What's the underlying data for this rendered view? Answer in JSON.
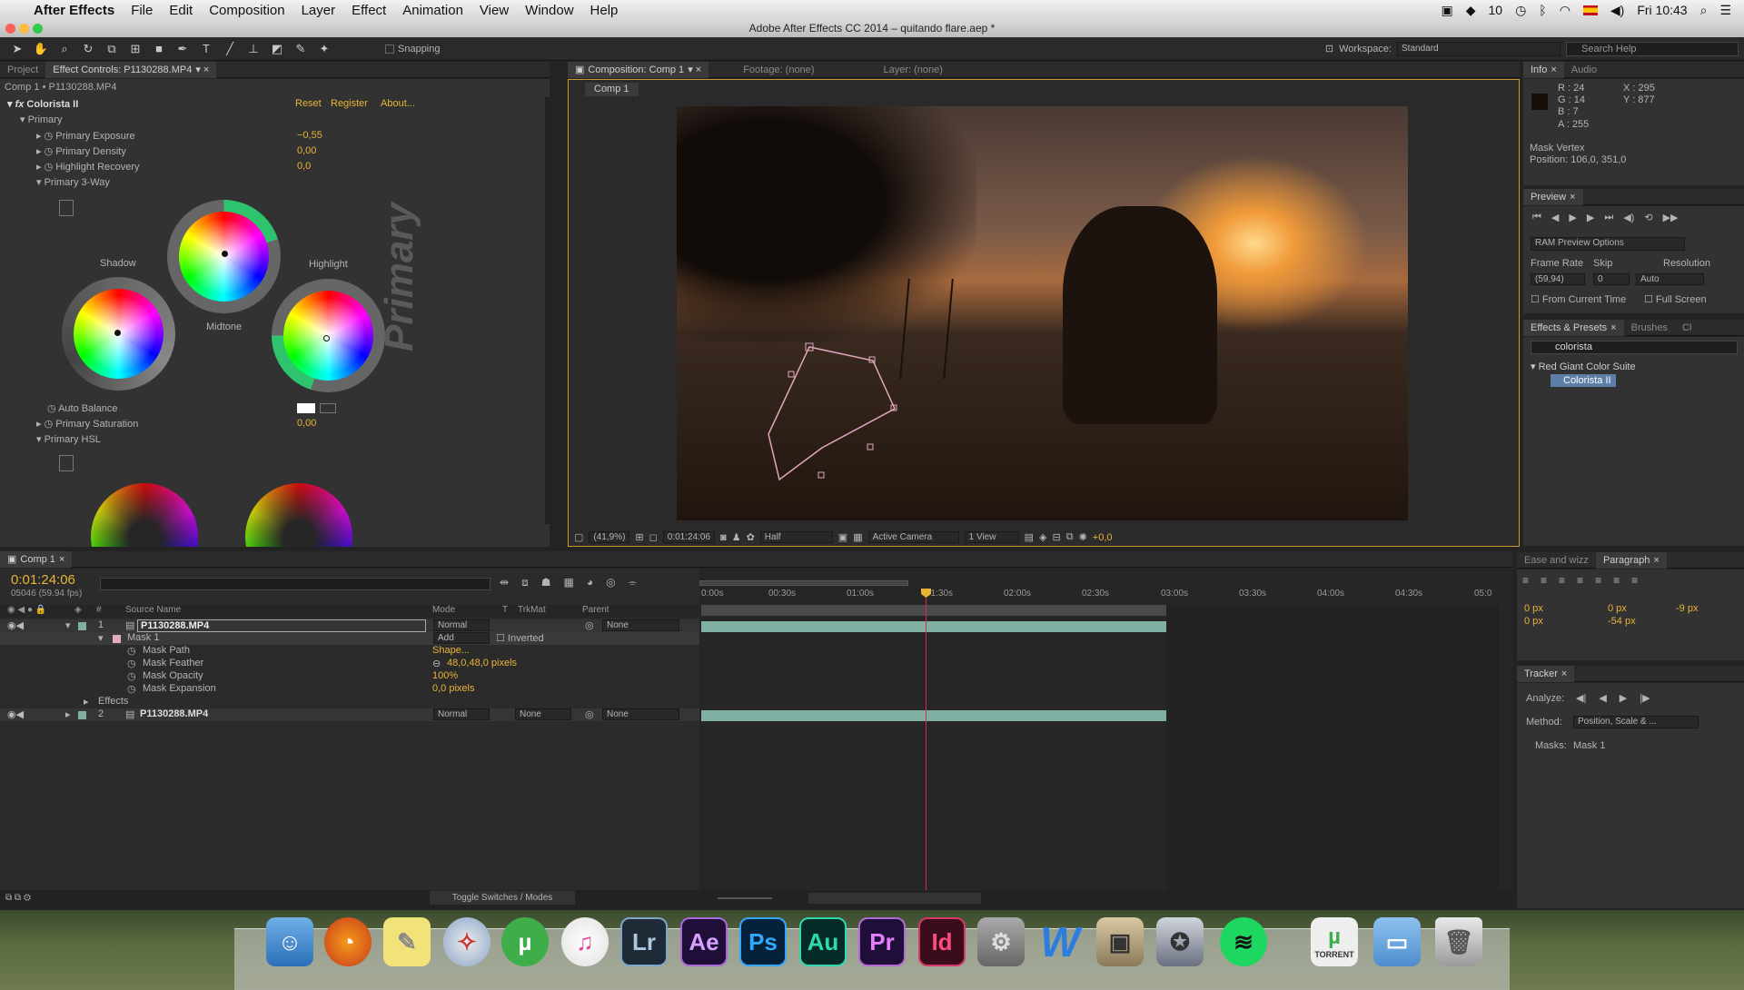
{
  "menubar": {
    "app": "After Effects",
    "items": [
      "File",
      "Edit",
      "Composition",
      "Layer",
      "Effect",
      "Animation",
      "View",
      "Window",
      "Help"
    ],
    "status_number": "10",
    "clock": "Fri 10:43"
  },
  "window_title": "Adobe After Effects CC 2014 – quitando flare.aep *",
  "toolbar": {
    "snapping": "Snapping",
    "workspace_label": "Workspace:",
    "workspace_value": "Standard",
    "search_placeholder": "Search Help"
  },
  "left_panel": {
    "tab_project": "Project",
    "tab_effect_controls": "Effect Controls: P1130288.MP4",
    "breadcrumb": "Comp 1 • P1130288.MP4",
    "effect_name": "Colorista II",
    "reset": "Reset",
    "register": "Register",
    "about": "About...",
    "primary_group": "Primary",
    "props": [
      {
        "label": "Primary Exposure",
        "value": "−0,55"
      },
      {
        "label": "Primary Density",
        "value": "0,00"
      },
      {
        "label": "Highlight Recovery",
        "value": "0,0"
      }
    ],
    "three_way": "Primary 3-Way",
    "shadow": "Shadow",
    "midtone": "Midtone",
    "highlight": "Highlight",
    "watermark": "Primary",
    "auto_balance": "Auto Balance",
    "primary_saturation": "Primary Saturation",
    "primary_saturation_value": "0,00",
    "primary_hsl": "Primary HSL"
  },
  "comp_panel": {
    "tab_comp": "Composition: Comp 1",
    "tab_footage": "Footage: (none)",
    "tab_layer": "Layer: (none)",
    "subtab": "Comp 1",
    "zoom": "(41,9%)",
    "timecode": "0:01:24:06",
    "resolution": "Half",
    "camera": "Active Camera",
    "views": "1 View",
    "exposure": "+0,0"
  },
  "info_panel": {
    "tab_info": "Info",
    "tab_audio": "Audio",
    "r": "R : 24",
    "g": "G : 14",
    "b": "B : 7",
    "a": "A : 255",
    "x": "X : 295",
    "y": "Y : 877",
    "mask_vertex": "Mask Vertex",
    "position": "Position: 106,0, 351,0"
  },
  "preview_panel": {
    "tab": "Preview",
    "ram_options": "RAM Preview Options",
    "frame_rate_label": "Frame Rate",
    "skip_label": "Skip",
    "resolution_label": "Resolution",
    "frame_rate_value": "(59,94)",
    "skip_value": "0",
    "resolution_value": "Auto",
    "from_current": "From Current Time",
    "full_screen": "Full Screen"
  },
  "effects_panel": {
    "tab_effects": "Effects & Presets",
    "tab_brushes": "Brushes",
    "tab_ch": "Cl",
    "search_value": "colorista",
    "folder": "Red Giant Color Suite",
    "item": "Colorista II"
  },
  "timeline": {
    "tab": "Comp 1",
    "timecode": "0:01:24:06",
    "frames": "05046 (59.94 fps)",
    "col_source": "Source Name",
    "col_mode": "Mode",
    "col_t": "T",
    "col_trkmat": "TrkMat",
    "col_parent": "Parent",
    "ruler": [
      "0:00s",
      "00:30s",
      "01:00s",
      "01:30s",
      "02:00s",
      "02:30s",
      "03:00s",
      "03:30s",
      "04:00s",
      "04:30s",
      "05:0"
    ],
    "layer1": {
      "num": "1",
      "name": "P1130288.MP4",
      "mode": "Normal",
      "parent": "None"
    },
    "mask": {
      "name": "Mask 1",
      "mode": "Add",
      "inverted": "Inverted"
    },
    "mask_props": [
      {
        "label": "Mask Path",
        "value": "Shape..."
      },
      {
        "label": "Mask Feather",
        "value": "48,0,48,0 pixels"
      },
      {
        "label": "Mask Opacity",
        "value": "100%"
      },
      {
        "label": "Mask Expansion",
        "value": "0,0 pixels"
      }
    ],
    "effects": "Effects",
    "layer2": {
      "num": "2",
      "name": "P1130288.MP4",
      "mode": "Normal",
      "trkmat": "None",
      "parent": "None"
    },
    "toggle": "Toggle Switches / Modes"
  },
  "paragraph_panel": {
    "tab_ease": "Ease and wizz",
    "tab_paragraph": "Paragraph",
    "v1": "0 px",
    "v2": "0 px",
    "v3": "-9 px",
    "v4": "0 px",
    "v5": "-54 px"
  },
  "tracker_panel": {
    "tab": "Tracker",
    "analyze": "Analyze:",
    "method_label": "Method:",
    "method_value": "Position, Scale & ...",
    "masks_label": "Masks:",
    "masks_value": "Mask 1"
  },
  "dock": {
    "lr": "Lr",
    "ae": "Ae",
    "ps": "Ps",
    "au": "Au",
    "pr": "Pr",
    "id": "Id",
    "w": "W",
    "torrent": "TORRENT"
  },
  "colors": {
    "accent": "#e8b436",
    "selection": "#5d7ea6",
    "clip": "#7fb0a3"
  }
}
